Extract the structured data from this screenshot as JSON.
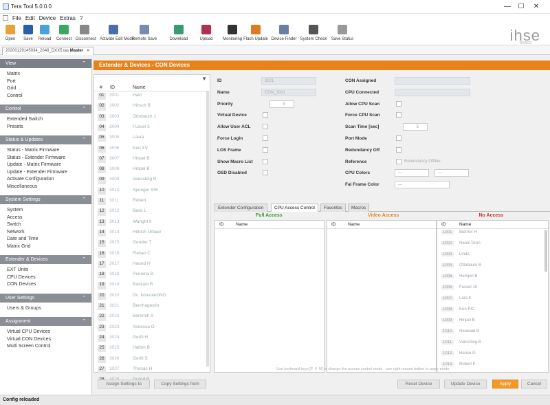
{
  "window": {
    "title": "Tera Tool 5.0.0.0",
    "minimize": "—",
    "maximize": "☐",
    "close": "✕"
  },
  "menu": [
    "File",
    "Edit",
    "Device",
    "Extras",
    "?"
  ],
  "toolbar": [
    {
      "label": "Open",
      "icon": "folder-icon",
      "color": "#e8a23a"
    },
    {
      "label": "Save",
      "icon": "save-icon",
      "color": "#2a5fa8"
    },
    {
      "label": "Reload",
      "icon": "reload-icon",
      "color": "#4aa0d8"
    },
    {
      "label": "Connect",
      "icon": "connect-icon",
      "color": "#3aa860"
    },
    {
      "label": "Disconnect",
      "icon": "disconnect-icon",
      "color": "#888888"
    },
    {
      "label": "Activate Edit Mode",
      "icon": "edit-mode-icon",
      "color": "#4a6ea8"
    },
    {
      "label": "Remote Save",
      "icon": "remote-save-icon",
      "color": "#7a8ab0"
    },
    {
      "label": "Download",
      "icon": "download-icon",
      "color": "#3a9a70"
    },
    {
      "label": "Upload",
      "icon": "upload-icon",
      "color": "#b03050"
    },
    {
      "label": "Monitoring",
      "icon": "monitoring-icon",
      "color": "#333333"
    },
    {
      "label": "Flash Update",
      "icon": "flash-update-icon",
      "color": "#e07a20"
    },
    {
      "label": "Device Finder",
      "icon": "device-finder-icon",
      "color": "#6a7fa0"
    },
    {
      "label": "System Check",
      "icon": "system-check-icon",
      "color": "#555555"
    },
    {
      "label": "Save Status",
      "icon": "save-status-icon",
      "color": "#999999"
    }
  ],
  "logo": {
    "text": "ihse",
    "sub": "DRACO TERA"
  },
  "doc_tab": {
    "path": "20200129145034_2048_DXX5.tas",
    "bold": "Master",
    "close": "✕"
  },
  "sidebar": [
    {
      "header": "View",
      "items": [
        "Matrix",
        "Port",
        "Grid",
        "Control"
      ]
    },
    {
      "header": "Control",
      "items": [
        "Extended Switch",
        "Presets"
      ]
    },
    {
      "header": "Status & Updates",
      "items": [
        "Status - Matrix Firmware",
        "Status - Extender Firmware",
        "Update - Matrix Firmware",
        "Update - Extender Firmware",
        "Activate Configuration",
        "Miscellaneous"
      ]
    },
    {
      "header": "System Settings",
      "items": [
        "System",
        "Access",
        "Switch",
        "Network",
        "Date and Time",
        "Matrix Grid"
      ]
    },
    {
      "header": "Extender & Devices",
      "items": [
        "EXT Units",
        "CPU Devices",
        "CON Devices"
      ]
    },
    {
      "header": "User Settings",
      "items": [
        "Users & Groups"
      ]
    },
    {
      "header": "Assignment",
      "items": [
        "Virtual CPU Devices",
        "Virtual CON Devices",
        "Multi Screen Control"
      ]
    }
  ],
  "section_title": "Extender & Devices - CON Devices",
  "list": {
    "filter_icon": "▼",
    "headers": {
      "num": "#",
      "id": "ID",
      "name": "Name"
    },
    "rows": [
      {
        "n": "01",
        "id": "3001",
        "name": "Halo"
      },
      {
        "n": "02",
        "id": "3002",
        "name": "Hinsch B"
      },
      {
        "n": "03",
        "id": "3003",
        "name": "Ottobaum 1"
      },
      {
        "n": "04",
        "id": "3004",
        "name": "Fussel 3"
      },
      {
        "n": "05",
        "id": "3005",
        "name": "Laura"
      },
      {
        "n": "06",
        "id": "3006",
        "name": "Ken XV"
      },
      {
        "n": "07",
        "id": "3007",
        "name": "Hinpel B"
      },
      {
        "n": "08",
        "id": "3008",
        "name": "Hinpel B"
      },
      {
        "n": "09",
        "id": "3009",
        "name": "Vanssteig B"
      },
      {
        "n": "10",
        "id": "3010",
        "name": "Springer SW"
      },
      {
        "n": "11",
        "id": "3011",
        "name": "Robert"
      },
      {
        "n": "12",
        "id": "3012",
        "name": "Beck L"
      },
      {
        "n": "13",
        "id": "3013",
        "name": "Wanght II"
      },
      {
        "n": "14",
        "id": "3014",
        "name": "Hiltrich Urbaer"
      },
      {
        "n": "15",
        "id": "3015",
        "name": "Gender T"
      },
      {
        "n": "16",
        "id": "3016",
        "name": "Fleiser C"
      },
      {
        "n": "17",
        "id": "3017",
        "name": "Haund H"
      },
      {
        "n": "18",
        "id": "3018",
        "name": "Pennina B"
      },
      {
        "n": "19",
        "id": "3019",
        "name": "Bastiani R"
      },
      {
        "n": "20",
        "id": "3020",
        "name": "Gc. konsoleDNO"
      },
      {
        "n": "21",
        "id": "3021",
        "name": "Bernhagestin"
      },
      {
        "n": "22",
        "id": "3022",
        "name": "Beremih S"
      },
      {
        "n": "23",
        "id": "3023",
        "name": "Yanessa O"
      },
      {
        "n": "24",
        "id": "3024",
        "name": "Gerfil H"
      },
      {
        "n": "25",
        "id": "3025",
        "name": "Halbm B"
      },
      {
        "n": "26",
        "id": "3026",
        "name": "Gerfil S"
      },
      {
        "n": "27",
        "id": "3027",
        "name": "Thonas H"
      },
      {
        "n": "28",
        "id": "3028",
        "name": "Grand B"
      }
    ]
  },
  "detail": {
    "left": [
      {
        "label": "ID",
        "kind": "field",
        "value": "3001"
      },
      {
        "label": "Name",
        "kind": "field",
        "value": "CON_3001"
      },
      {
        "label": "Priority",
        "kind": "spin",
        "value": "0"
      },
      {
        "label": "Virtual Device",
        "kind": "check"
      },
      {
        "label": "Allow User ACL",
        "kind": "check"
      },
      {
        "label": "Force Login",
        "kind": "check"
      },
      {
        "label": "LOS Frame",
        "kind": "check"
      },
      {
        "label": "Show Macro List",
        "kind": "check"
      },
      {
        "label": "OSD Disabled",
        "kind": "check"
      }
    ],
    "right": [
      {
        "label": "CON Assigned",
        "kind": "field",
        "value": ""
      },
      {
        "label": "CPU Connected",
        "kind": "field",
        "value": ""
      },
      {
        "label": "Allow CPU Scan",
        "kind": "check"
      },
      {
        "label": "Force CPU Scan",
        "kind": "check"
      },
      {
        "label": "Scan Time [sec]",
        "kind": "spin",
        "value": "5"
      },
      {
        "label": "Port Mode",
        "kind": "check"
      },
      {
        "label": "Redundancy Off",
        "kind": "check"
      },
      {
        "label": "Reference",
        "kind": "checktext",
        "value": "Redundancy Offline"
      },
      {
        "label": "CPU Colors",
        "kind": "dual",
        "value": "—",
        "value2": "—"
      },
      {
        "label": "Fal Frame Color",
        "kind": "dd",
        "value": "—"
      }
    ]
  },
  "subtabs": [
    "Extender Configuration",
    "CPU Access Control",
    "Favorites",
    "Macros"
  ],
  "subtab_active": 1,
  "access": {
    "columns": [
      {
        "title": "Full Access",
        "color": "#3a9a3a",
        "id": "ID",
        "name": "Name",
        "rows": []
      },
      {
        "title": "Video Access",
        "color": "#e8821a",
        "id": "ID",
        "name": "Name",
        "rows": []
      },
      {
        "title": "No Access",
        "color": "#d03030",
        "id": "ID",
        "name": "Name",
        "rows": [
          {
            "id": "1001",
            "name": "Biertrer H"
          },
          {
            "id": "1002",
            "name": "Hanni Gren"
          },
          {
            "id": "1003",
            "name": "Linda"
          },
          {
            "id": "1004",
            "name": "Ottobaum B"
          },
          {
            "id": "1005",
            "name": "Hempel B"
          },
          {
            "id": "1006",
            "name": "Fussel 15"
          },
          {
            "id": "1007",
            "name": "Lara K"
          },
          {
            "id": "1008",
            "name": "Ken PIC"
          },
          {
            "id": "1009",
            "name": "Hinpel B"
          },
          {
            "id": "1010",
            "name": "Hanwaid B"
          },
          {
            "id": "1011",
            "name": "Vanssteig B"
          },
          {
            "id": "1012",
            "name": "Hanse G"
          },
          {
            "id": "1013",
            "name": "Robert K"
          }
        ]
      }
    ]
  },
  "hint": "Use keyboard keys [F, V, N] or change the access control mode - use right mouse button to apply mode",
  "buttons": {
    "left1": "Assign Settings to",
    "left2": "Copy Settings from",
    "r1": "Reset Device",
    "r2": "Update Device",
    "apply": "Apply",
    "cancel": "Cancel"
  },
  "status": "Config reloaded"
}
